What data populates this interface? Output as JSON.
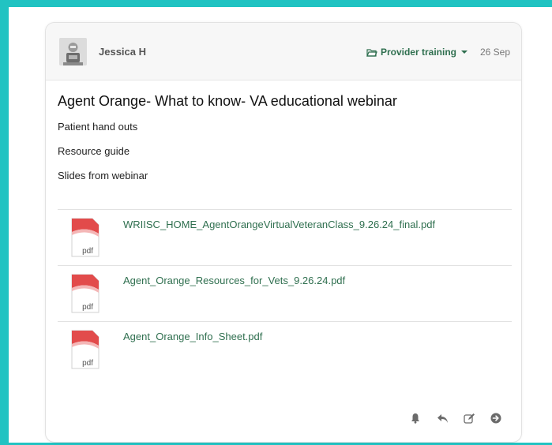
{
  "post": {
    "author": "Jessica H",
    "category": "Provider training",
    "date": "26 Sep",
    "title": "Agent Orange- What to know- VA educational webinar",
    "body_lines": [
      "Patient hand outs",
      "Resource guide",
      "Slides from webinar"
    ]
  },
  "attachments": [
    {
      "name": "WRIISC_HOME_AgentOrangeVirtualVeteranClass_9.26.24_final.pdf",
      "type_label": "pdf"
    },
    {
      "name": "Agent_Orange_Resources_for_Vets_9.26.24.pdf",
      "type_label": "pdf"
    },
    {
      "name": "Agent_Orange_Info_Sheet.pdf",
      "type_label": "pdf"
    }
  ],
  "actions": [
    "bell-icon",
    "reply-icon",
    "edit-icon",
    "forward-icon"
  ],
  "colors": {
    "frame": "#21c3c2",
    "link": "#2f6f4f"
  }
}
